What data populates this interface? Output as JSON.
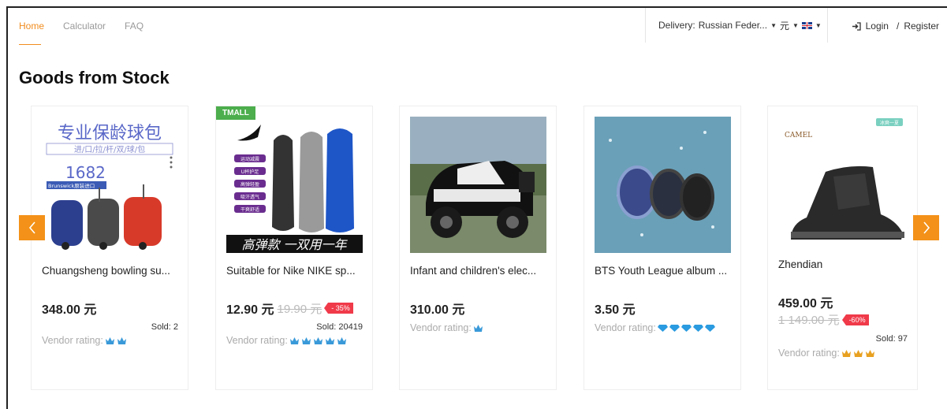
{
  "nav": {
    "items": [
      "Home",
      "Calculator",
      "FAQ"
    ]
  },
  "delivery": {
    "label": "Delivery:",
    "country": "Russian Feder...",
    "currency": "元"
  },
  "auth": {
    "login": "Login",
    "separator": "/",
    "register": "Register"
  },
  "section": {
    "title": "Goods from Stock"
  },
  "products": [
    {
      "name": "Chuangsheng bowling su...",
      "price": "348.00 元",
      "sold": "Sold: 2",
      "rating_label": "Vendor rating:",
      "rating_icons": 2,
      "rating_type": "crown-blue"
    },
    {
      "badge": "TMALL",
      "name": "Suitable for Nike NIKE sp...",
      "price": "12.90 元",
      "old_price": "19.90 元",
      "discount": "- 35%",
      "sold": "Sold: 20419",
      "rating_label": "Vendor rating:",
      "rating_icons": 5,
      "rating_type": "crown-blue"
    },
    {
      "name": "Infant and children's elec...",
      "price": "310.00 元",
      "rating_label": "Vendor rating:",
      "rating_icons": 1,
      "rating_type": "crown-blue"
    },
    {
      "name": "BTS Youth League album ...",
      "price": "3.50 元",
      "rating_label": "Vendor rating:",
      "rating_icons": 5,
      "rating_type": "diamond"
    },
    {
      "name": "Zhendian",
      "price": "459.00 元",
      "old_price": "1 149.00 元",
      "discount": "-60%",
      "sold": "Sold: 97",
      "rating_label": "Vendor rating:",
      "rating_icons": 3,
      "rating_type": "crown-gold"
    }
  ],
  "image_text": {
    "p1_line1": "专业保龄球包",
    "p1_line2": "进/口/拉/杆/双/球/包",
    "p1_count": "1682",
    "p1_brand": "Brunswick原装进口",
    "p2_bottom": "高弹款 一双用一年",
    "p2_tags": [
      "运动减震",
      "U杯护足",
      "高弹轻盈",
      "吸汗透气",
      "干爽舒适"
    ],
    "p5_brand": "CAMEL",
    "p5_tag": "冰爽一夏"
  },
  "colors": {
    "accent": "#f08c1e",
    "arrow": "#f39118",
    "discount": "#f03a4a",
    "tmall": "#4cae4c"
  }
}
